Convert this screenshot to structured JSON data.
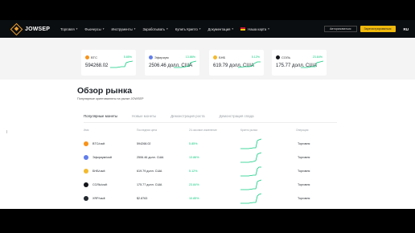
{
  "brand": {
    "name": "JOWSEP"
  },
  "nav": {
    "menu": [
      {
        "label": "Торговля",
        "has_chevron": true
      },
      {
        "label": "Фьючерсы",
        "has_chevron": true
      },
      {
        "label": "Инструменты",
        "has_chevron": true
      },
      {
        "label": "Заработывать",
        "has_chevron": true
      },
      {
        "label": "Купить Крипто",
        "has_chevron": true
      },
      {
        "label": "Документация",
        "has_chevron": true
      },
      {
        "label": "Наша карта",
        "has_chevron": true
      }
    ],
    "login_label": "Авторизоваться",
    "register_label": "Зарегистрироваться",
    "lang": "RU"
  },
  "colors": {
    "accent": "#f0b90b",
    "positive": "#0ecb81",
    "nav_bg": "#0b0e11"
  },
  "tickers": [
    {
      "name": "BTC",
      "pct": "5.85%",
      "price": "594268.02",
      "coin_color": "#f7931a"
    },
    {
      "name": "Эфириум",
      "pct": "13.86%",
      "price": "2506.46 долл. США",
      "coin_color": "#627eea"
    },
    {
      "name": "БНБ",
      "pct": "5.12%",
      "price": "619.79 долл. США",
      "coin_color": "#f3ba2f"
    },
    {
      "name": "СОЛЬ",
      "pct": "23.84%",
      "price": "175.77 долл. США",
      "coin_color": "#14151a"
    }
  ],
  "market": {
    "title": "Обзор рынка",
    "subtitle": "Популярные криптовалюты на рынке JOWSEP",
    "tabs": [
      "Популярные монеты",
      "Новые монеты",
      "Демонстрация роста",
      "Демонстрация спада"
    ],
    "headers": [
      "Имя",
      "Последняя цена",
      "24-часовое изменение",
      "Крипто рынка",
      "Операция"
    ],
    "rows": [
      {
        "pair": "BTC/usdt",
        "price": "594268.02",
        "change": "5.85%",
        "action": "Торговля",
        "coin_color": "#f7931a",
        "glyph": "₿"
      },
      {
        "pair": "Эфириум/usdt",
        "price": "2506.46 долл. США",
        "change": "13.86%",
        "action": "Торговля",
        "coin_color": "#627eea",
        "glyph": "◆"
      },
      {
        "pair": "БНБ/usdt",
        "price": "619.79 долл. США",
        "change": "5.12%",
        "action": "Торговля",
        "coin_color": "#f3ba2f",
        "glyph": "◈"
      },
      {
        "pair": "СОЛЬ/usdt",
        "price": "175.77 долл. США",
        "change": "23.84%",
        "action": "Торговля",
        "coin_color": "#14151a",
        "glyph": "≡"
      },
      {
        "pair": "XRP/usdt",
        "price": "$2.8763",
        "change": "10.85%",
        "action": "Торговля",
        "coin_color": "#23292f",
        "glyph": "✕"
      }
    ]
  }
}
